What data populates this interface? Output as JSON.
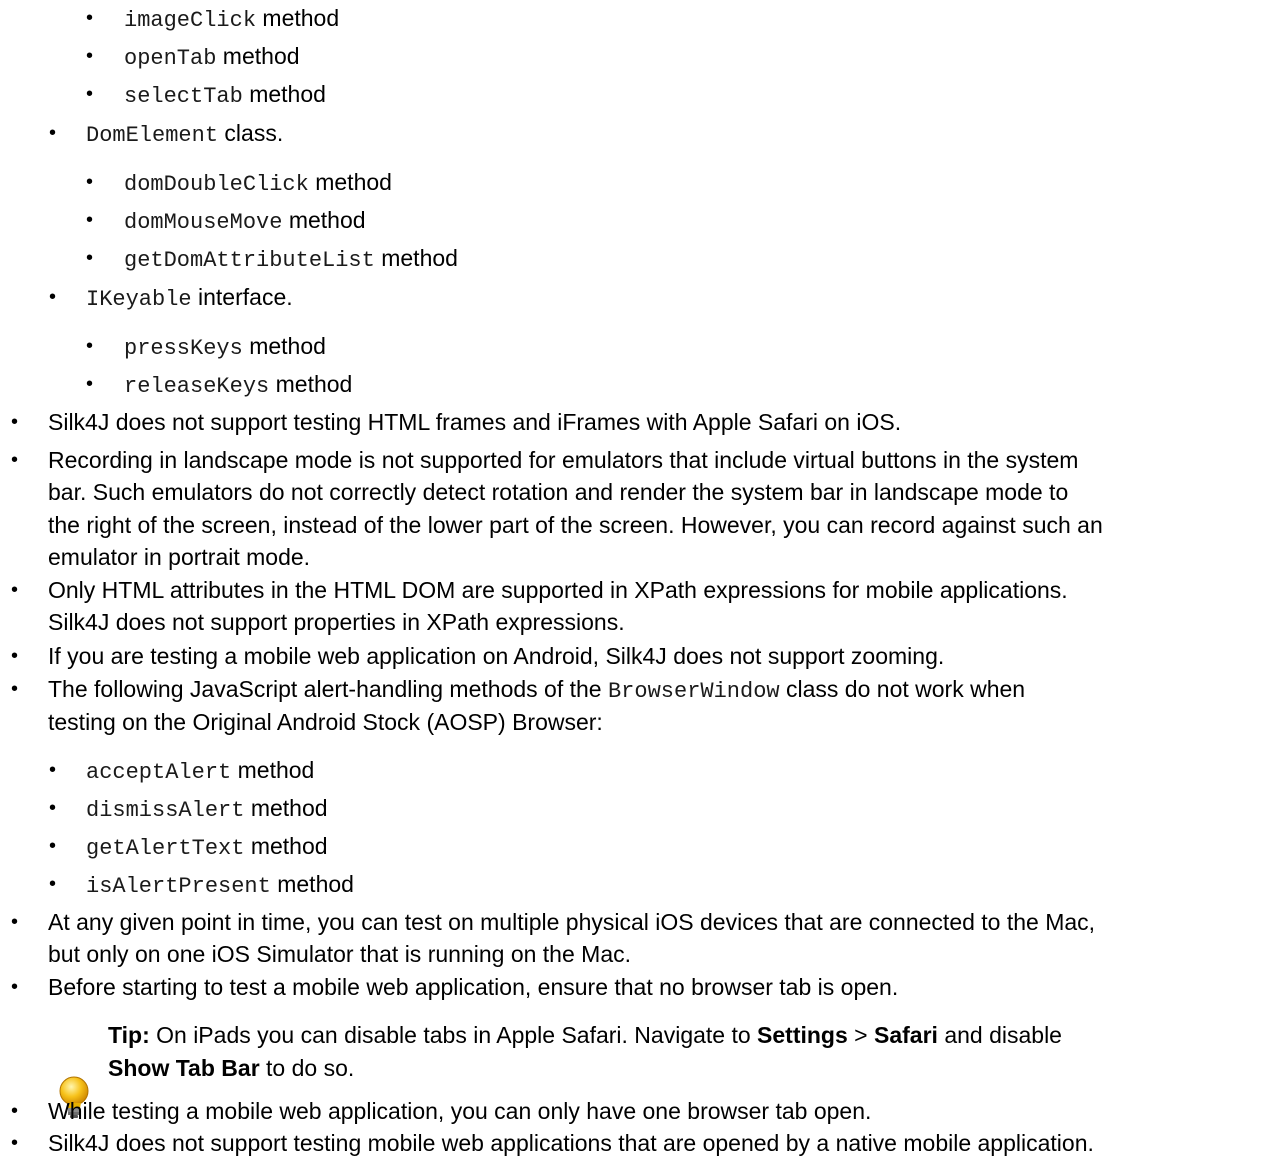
{
  "top_sublist": {
    "items": [
      {
        "code": "imageClick",
        "suffix": " method"
      },
      {
        "code": "openTab",
        "suffix": " method"
      },
      {
        "code": "selectTab",
        "suffix": " method"
      }
    ]
  },
  "domelement": {
    "code": "DomElement",
    "suffix": " class."
  },
  "domelement_methods": [
    {
      "code": "domDoubleClick",
      "suffix": " method"
    },
    {
      "code": "domMouseMove",
      "suffix": " method"
    },
    {
      "code": "getDomAttributeList",
      "suffix": " method"
    }
  ],
  "ikeyable": {
    "code": "IKeyable",
    "suffix": " interface."
  },
  "ikeyable_methods": [
    {
      "code": "pressKeys",
      "suffix": " method"
    },
    {
      "code": "releaseKeys",
      "suffix": " method"
    }
  ],
  "bullets": {
    "frames": "Silk4J does not support testing HTML frames and iFrames with Apple Safari on iOS.",
    "landscape": [
      "Recording in landscape mode is not supported for emulators that include virtual buttons in the system",
      "bar. Such emulators do not correctly detect rotation and render the system bar in landscape mode to",
      "the right of the screen, instead of the lower part of the screen. However, you can record against such an",
      "emulator in portrait mode."
    ],
    "xpath": [
      "Only HTML attributes in the HTML DOM are supported in XPath expressions for mobile applications.",
      "Silk4J does not support properties in XPath expressions."
    ],
    "zoom": "If you are testing a mobile web application on Android, Silk4J does not support zooming.",
    "alert_intro_a": "The following JavaScript alert-handling methods of the ",
    "alert_intro_code": "BrowserWindow",
    "alert_intro_b": " class do not work when",
    "alert_intro_line2": "testing on the Original Android Stock (AOSP) Browser:",
    "multiple_ios": [
      "At any given point in time, you can test on multiple physical iOS devices that are connected to the Mac,",
      "but only on one iOS Simulator that is running on the Mac."
    ],
    "no_tab": "Before starting to test a mobile web application, ensure that no browser tab is open.",
    "one_tab": "While testing a mobile web application, you can only have one browser tab open.",
    "native": "Silk4J does not support testing mobile web applications that are opened by a native mobile application."
  },
  "alert_methods": [
    {
      "code": "acceptAlert",
      "suffix": " method"
    },
    {
      "code": "dismissAlert",
      "suffix": " method"
    },
    {
      "code": "getAlertText",
      "suffix": " method"
    },
    {
      "code": "isAlertPresent",
      "suffix": " method"
    }
  ],
  "tip": {
    "label": "Tip:",
    "text1": " On iPads you can disable tabs in Apple Safari. Navigate to ",
    "settings": "Settings",
    "sep": " > ",
    "safari": "Safari",
    "text2": " and disable",
    "show_tab_bar": "Show Tab Bar",
    "text3": " to do so."
  },
  "icons": {
    "tip": "lightbulb-icon",
    "bullet": "•"
  }
}
